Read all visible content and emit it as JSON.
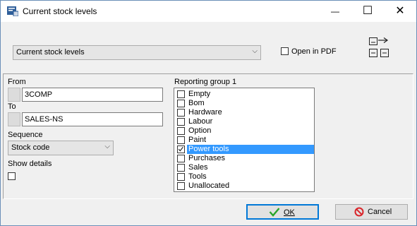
{
  "window": {
    "title": "Current stock levels",
    "minimize_glyph": "—",
    "maximize_glyph": "☐",
    "close_glyph": "✕"
  },
  "report": {
    "selected": "Current stock levels",
    "open_in_pdf_label": "Open in PDF",
    "open_in_pdf_checked": false
  },
  "range": {
    "from_label": "From",
    "from_value": "3COMP",
    "to_label": "To",
    "to_value": "SALES-NS"
  },
  "sequence": {
    "label": "Sequence",
    "selected": "Stock code"
  },
  "show_details": {
    "label": "Show details",
    "checked": false
  },
  "reporting_group": {
    "label": "Reporting group 1",
    "items": [
      {
        "label": "Empty",
        "checked": false
      },
      {
        "label": "Bom",
        "checked": false
      },
      {
        "label": "Hardware",
        "checked": false
      },
      {
        "label": "Labour",
        "checked": false
      },
      {
        "label": "Option",
        "checked": false
      },
      {
        "label": "Paint",
        "checked": false
      },
      {
        "label": "Power tools",
        "checked": true
      },
      {
        "label": "Purchases",
        "checked": false
      },
      {
        "label": "Sales",
        "checked": false
      },
      {
        "label": "Tools",
        "checked": false
      },
      {
        "label": "Unallocated",
        "checked": false
      }
    ]
  },
  "buttons": {
    "ok_label": "OK",
    "cancel_label": "Cancel"
  },
  "colors": {
    "selection": "#3399ff",
    "ok_check": "#2aa52a",
    "cancel_icon": "#d9262c"
  }
}
